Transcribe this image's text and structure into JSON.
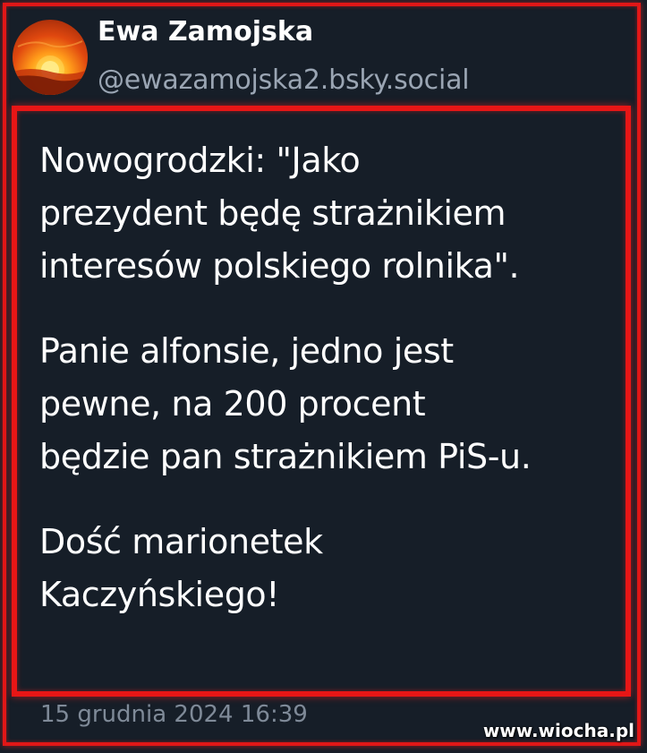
{
  "author": {
    "display_name": "Ewa Zamojska",
    "handle": "@ewazamojska2.bsky.social",
    "avatar_icon": "sunset-avatar-icon"
  },
  "post": {
    "paragraphs": [
      "Nowogrodzki: \"Jako\nprezydent będę strażnikiem\ninteresów polskiego rolnika\".",
      "Panie alfonsie, jedno jest\npewne, na 200 procent\nbędzie pan strażnikiem PiS-u.",
      "Dość marionetek\nKaczyńskiego!"
    ],
    "timestamp": "15 grudnia 2024 16:39"
  },
  "watermark": "www.wiocha.pl",
  "colors": {
    "background": "#161e28",
    "frame_red": "#e11717",
    "text": "#ffffff",
    "muted": "#9aa5b3"
  }
}
